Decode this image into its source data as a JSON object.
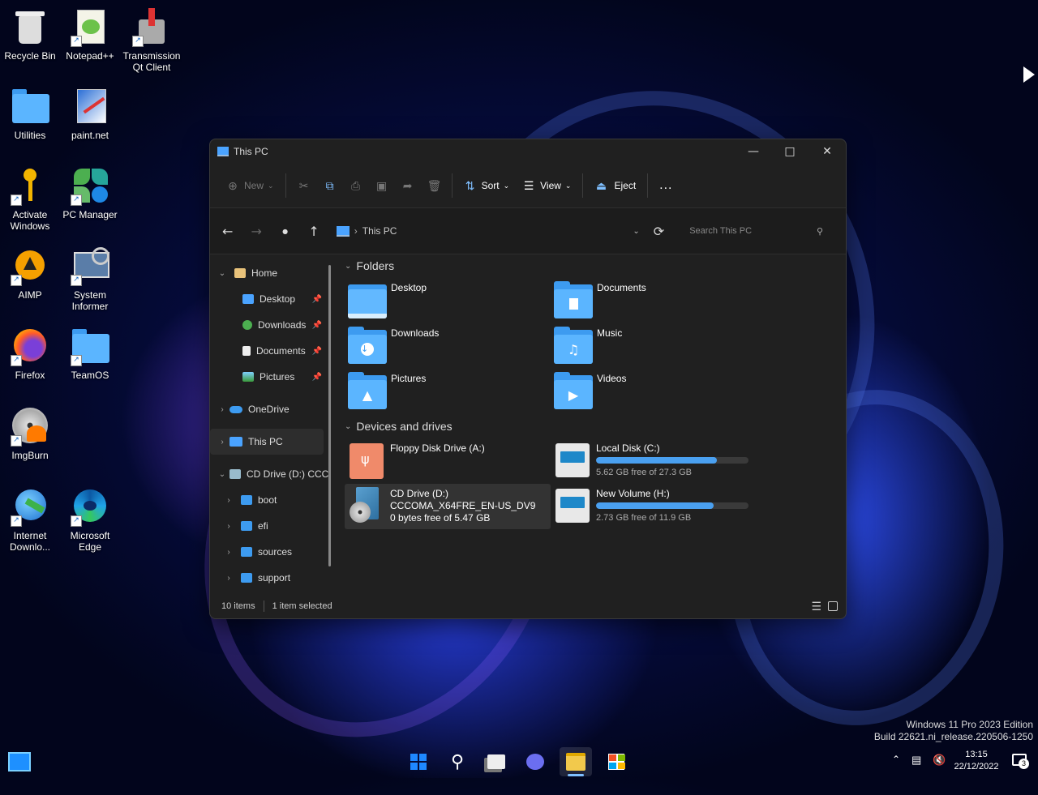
{
  "desktop": {
    "icons": [
      {
        "label": "Recycle Bin"
      },
      {
        "label": "Notepad++"
      },
      {
        "label": "Transmission Qt Client"
      },
      {
        "label": "Utilities"
      },
      {
        "label": "paint.net"
      },
      {
        "label": "Activate Windows"
      },
      {
        "label": "PC Manager"
      },
      {
        "label": "AIMP"
      },
      {
        "label": "System Informer"
      },
      {
        "label": "Firefox"
      },
      {
        "label": "TeamOS"
      },
      {
        "label": "ImgBurn"
      },
      {
        "label": "Internet Downlo..."
      },
      {
        "label": "Microsoft Edge"
      }
    ]
  },
  "window": {
    "title": "This PC",
    "toolbar": {
      "new_label": "New",
      "sort_label": "Sort",
      "view_label": "View",
      "eject_label": "Eject",
      "more_label": "..."
    },
    "address": {
      "path": "This PC",
      "search_placeholder": "Search This PC"
    },
    "nav": {
      "home": "Home",
      "desktop": "Desktop",
      "downloads": "Downloads",
      "documents": "Documents",
      "pictures": "Pictures",
      "onedrive": "OneDrive",
      "thispc": "This PC",
      "cddrive": "CD Drive (D:) CCC",
      "boot": "boot",
      "efi": "efi",
      "sources": "sources",
      "support": "support"
    },
    "content": {
      "folders_header": "Folders",
      "folders": [
        "Desktop",
        "Documents",
        "Downloads",
        "Music",
        "Pictures",
        "Videos"
      ],
      "drives_header": "Devices and drives",
      "drives": [
        {
          "name": "Floppy Disk Drive (A:)"
        },
        {
          "name": "Local Disk (C:)",
          "free": "5.62 GB free of 27.3 GB",
          "used_fraction": 0.79
        },
        {
          "name": "CD Drive (D:)",
          "label": "CCCOMA_X64FRE_EN-US_DV9",
          "free": "0 bytes free of 5.47 GB"
        },
        {
          "name": "New Volume (H:)",
          "free": "2.73 GB free of 11.9 GB",
          "used_fraction": 0.77
        }
      ]
    },
    "status": {
      "items": "10 items",
      "selected": "1 item selected"
    }
  },
  "watermark": {
    "line1": "Windows 11 Pro 2023 Edition",
    "line2": "Build 22621.ni_release.220506-1250"
  },
  "tray": {
    "time": "13:15",
    "date": "22/12/2022",
    "notifications": "3"
  },
  "colors": {
    "accent": "#3d9bf0",
    "window_bg": "#202020"
  }
}
